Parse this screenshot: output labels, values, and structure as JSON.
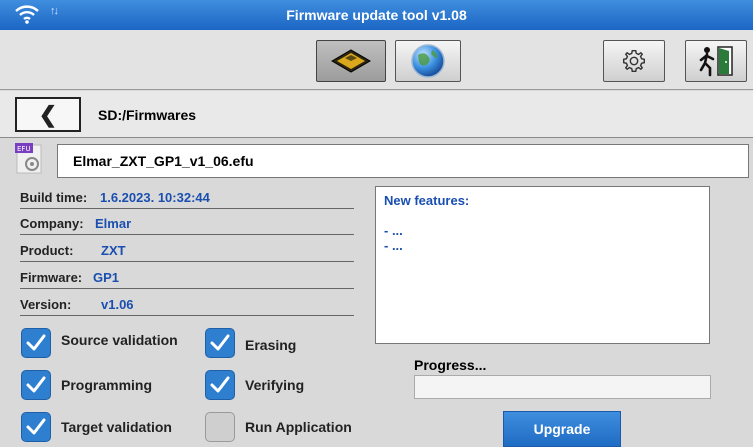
{
  "app": {
    "title": "Firmware update tool v1.08"
  },
  "status": {
    "wifi_icon": "wifi-icon",
    "transfer_icon": "transfer-arrows-icon",
    "transfer_text": "↑↓"
  },
  "toolbar": {
    "buttons": [
      {
        "name": "sd-card-button",
        "icon": "sd-card-icon",
        "active": true
      },
      {
        "name": "network-button",
        "icon": "globe-icon",
        "active": false
      },
      {
        "name": "settings-button",
        "icon": "gear-icon",
        "active": false
      },
      {
        "name": "exit-button",
        "icon": "exit-door-icon",
        "active": false
      }
    ]
  },
  "nav": {
    "back_glyph": "❮",
    "path": "SD:/Firmwares"
  },
  "file": {
    "icon_tag": "EFU",
    "name": "Elmar_ZXT_GP1_v1_06.efu"
  },
  "info": [
    {
      "label": "Build time:",
      "value": "1.6.2023. 10:32:44"
    },
    {
      "label": "Company:",
      "value": "Elmar"
    },
    {
      "label": "Product:",
      "value": "ZXT"
    },
    {
      "label": "Firmware:",
      "value": "GP1"
    },
    {
      "label": "Version:",
      "value": "v1.06"
    }
  ],
  "notes": {
    "title": "New features:",
    "lines": [
      "",
      "- ...",
      "- ..."
    ]
  },
  "options": [
    {
      "label": "Source validation",
      "checked": true
    },
    {
      "label": "Erasing",
      "checked": true
    },
    {
      "label": "Programming",
      "checked": true
    },
    {
      "label": "Verifying",
      "checked": true
    },
    {
      "label": "Target validation",
      "checked": true
    },
    {
      "label": "Run Application",
      "checked": false
    }
  ],
  "progress": {
    "label": "Progress...",
    "value": 0
  },
  "actions": {
    "upgrade_label": "Upgrade"
  },
  "colors": {
    "accent": "#2f7fd0",
    "value_text": "#1a4fb0"
  }
}
